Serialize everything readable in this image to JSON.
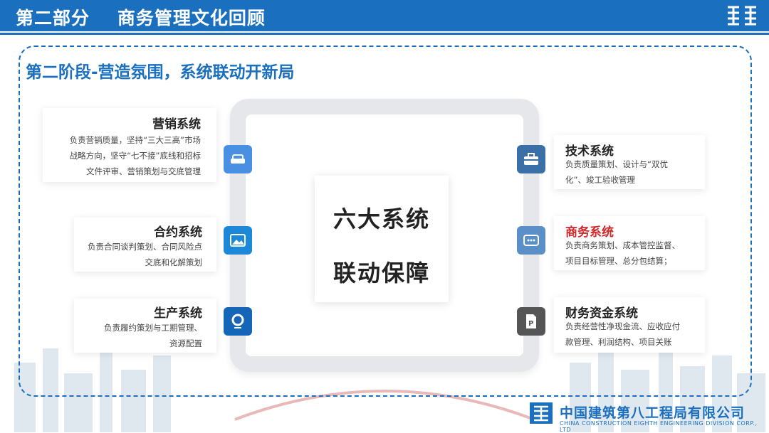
{
  "header": {
    "title": "第二部分    商务管理文化回顾"
  },
  "phase_title": "第二阶段-营造氛围，系统联动开新局",
  "center": {
    "line1": "六大系统",
    "line2": "联动保障"
  },
  "left_systems": [
    {
      "title": "营销系统",
      "desc": [
        "负责营销质量，坚持“三大三高”市场",
        "战略方向，坚守“七不接”底线和招标",
        "文件评审、营销策划与交底管理"
      ],
      "icon": "sofa-icon",
      "color": "#4a90e2"
    },
    {
      "title": "合约系统",
      "desc": [
        "负责合同谈判策划、合同风险点",
        "交底和化解策划"
      ],
      "icon": "image-icon",
      "color": "#1e88d8"
    },
    {
      "title": "生产系统",
      "desc": [
        "负责履约策划与工期管理、",
        "资源配置"
      ],
      "icon": "location-icon",
      "color": "#1565b8"
    }
  ],
  "right_systems": [
    {
      "title": "技术系统",
      "desc": [
        "负责质量策划、设计与“双优",
        "化”、竣工验收管理"
      ],
      "icon": "briefcase-icon",
      "color": "#3a6fa8",
      "highlight": false
    },
    {
      "title": "商务系统",
      "desc": [
        "负责商务策划、成本管控监督、",
        "项目目标管理、总分包结算；"
      ],
      "icon": "chat-icon",
      "color": "#5b8fc8",
      "highlight": true
    },
    {
      "title": "财务资金系统",
      "desc": [
        "负责经营性净现金流、应收应付",
        "款管理、利润结构、项目关账"
      ],
      "icon": "document-icon",
      "color": "#555555",
      "highlight": false
    }
  ],
  "colors": {
    "brand": "#1a6fbe",
    "highlight": "#d0282a"
  },
  "footer": {
    "company_cn": "中国建筑第八工程局有限公司",
    "company_en": "CHINA CONSTRUCTION EIGHTH ENGINEERING DIVISION CORP., LTD"
  }
}
